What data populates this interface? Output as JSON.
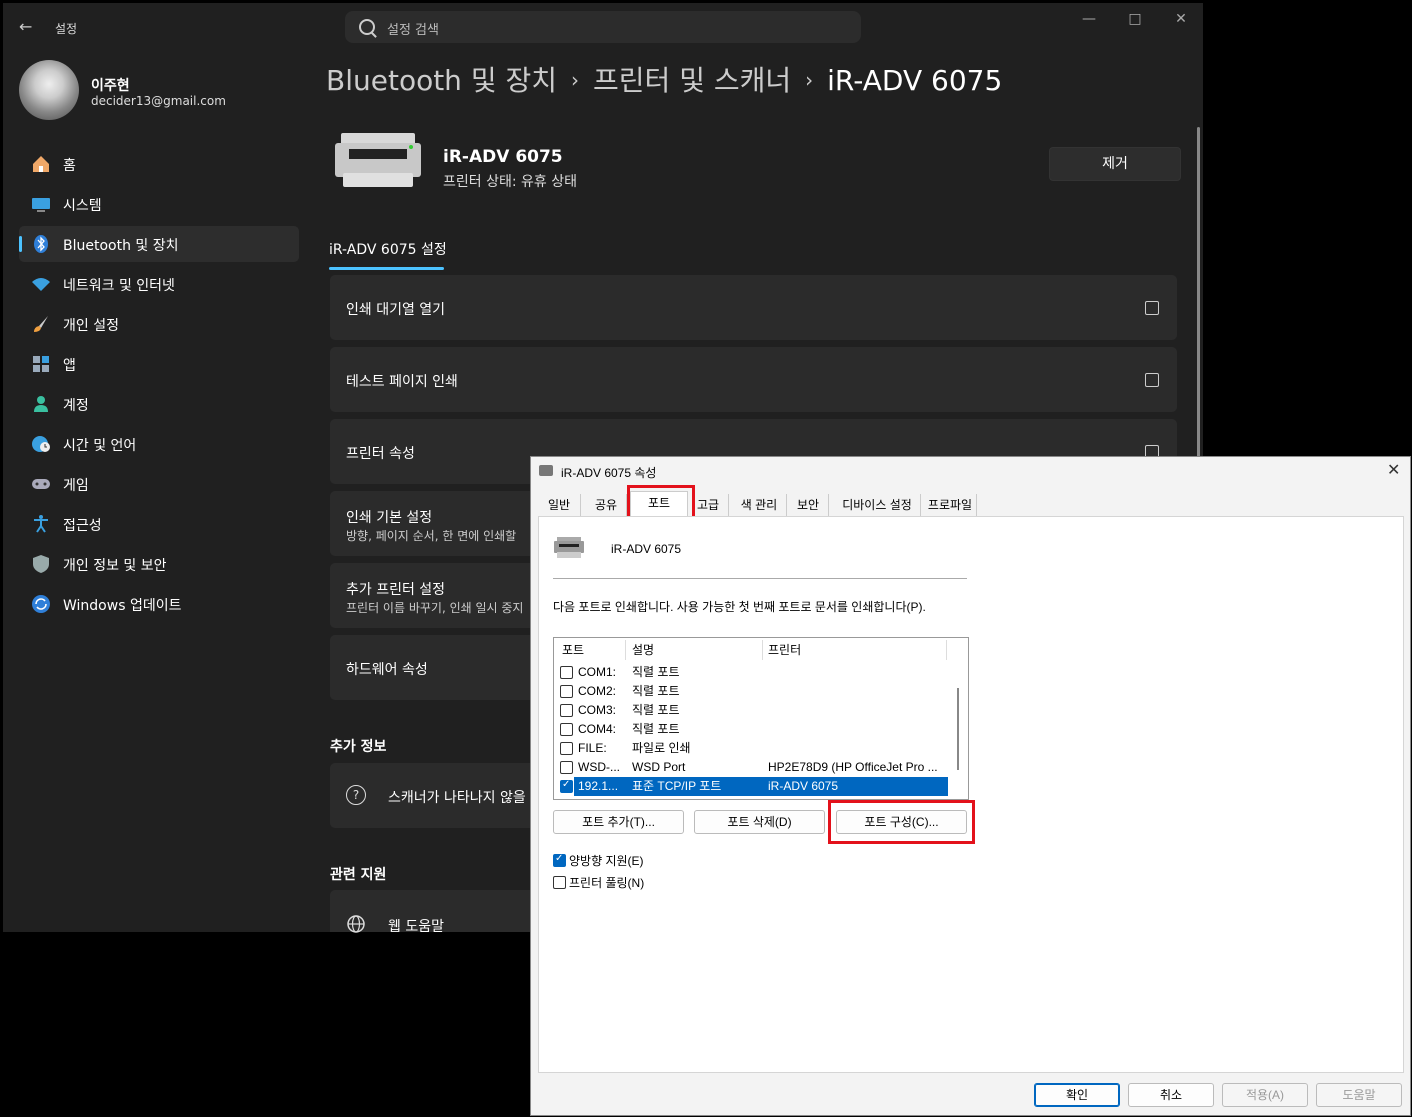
{
  "settings": {
    "title": "설정",
    "search_placeholder": "설정 검색",
    "user": {
      "name": "이주현",
      "email": "decider13@gmail.com"
    },
    "nav": [
      {
        "label": "홈",
        "icon": "home-icon"
      },
      {
        "label": "시스템",
        "icon": "system-icon"
      },
      {
        "label": "Bluetooth 및 장치",
        "icon": "bluetooth-icon",
        "active": true
      },
      {
        "label": "네트워크 및 인터넷",
        "icon": "wifi-icon"
      },
      {
        "label": "개인 설정",
        "icon": "brush-icon"
      },
      {
        "label": "앱",
        "icon": "apps-icon"
      },
      {
        "label": "계정",
        "icon": "account-icon"
      },
      {
        "label": "시간 및 언어",
        "icon": "globe-clock-icon"
      },
      {
        "label": "게임",
        "icon": "gamepad-icon"
      },
      {
        "label": "접근성",
        "icon": "accessibility-icon"
      },
      {
        "label": "개인 정보 및 보안",
        "icon": "shield-icon"
      },
      {
        "label": "Windows 업데이트",
        "icon": "update-icon"
      }
    ],
    "breadcrumb": [
      "Bluetooth 및 장치",
      "프린터 및 스캐너",
      "iR-ADV 6075"
    ],
    "printer": {
      "name": "iR-ADV 6075",
      "status": "프린터 상태:  유휴 상태",
      "remove_label": "제거"
    },
    "tab_label": "iR-ADV 6075 설정",
    "cards": [
      {
        "title": "인쇄 대기열 열기",
        "subtitle": ""
      },
      {
        "title": "테스트 페이지 인쇄",
        "subtitle": ""
      },
      {
        "title": "프린터 속성",
        "subtitle": ""
      },
      {
        "title": "인쇄 기본 설정",
        "subtitle": "방향, 페이지 순서, 한 면에 인쇄할"
      },
      {
        "title": "추가 프린터 설정",
        "subtitle": "프린터 이름 바꾸기, 인쇄 일시 중지"
      },
      {
        "title": "하드웨어 속성",
        "subtitle": ""
      }
    ],
    "more_info_heading": "추가 정보",
    "more_info_item": "스캐너가 나타나지 않을",
    "related_heading": "관련 지원",
    "related_item": "웹 도움말"
  },
  "dialog": {
    "title": "iR-ADV 6075 속성",
    "tabs": [
      "일반",
      "공유",
      "포트",
      "고급",
      "색 관리",
      "보안",
      "디바이스 설정",
      "프로파일"
    ],
    "selected_tab": "포트",
    "printer_name": "iR-ADV 6075",
    "instruction": "다음 포트로 인쇄합니다. 사용 가능한 첫 번째 포트로 문서를 인쇄합니다(P).",
    "columns": [
      "포트",
      "설명",
      "프린터"
    ],
    "ports": [
      {
        "port": "COM1:",
        "desc": "직렬 포트",
        "printer": "",
        "checked": false
      },
      {
        "port": "COM2:",
        "desc": "직렬 포트",
        "printer": "",
        "checked": false
      },
      {
        "port": "COM3:",
        "desc": "직렬 포트",
        "printer": "",
        "checked": false
      },
      {
        "port": "COM4:",
        "desc": "직렬 포트",
        "printer": "",
        "checked": false
      },
      {
        "port": "FILE:",
        "desc": "파일로 인쇄",
        "printer": "",
        "checked": false
      },
      {
        "port": "WSD-...",
        "desc": "WSD Port",
        "printer": "HP2E78D9 (HP OfficeJet Pro ...",
        "checked": false
      },
      {
        "port": "192.1...",
        "desc": "표준 TCP/IP 포트",
        "printer": "iR-ADV 6075",
        "checked": true,
        "selected": true
      }
    ],
    "add_port": "포트 추가(T)...",
    "delete_port": "포트 삭제(D)",
    "configure_port": "포트 구성(C)...",
    "bidirectional": {
      "label": "양방향 지원(E)",
      "checked": true
    },
    "pooling": {
      "label": "프린터 풀링(N)",
      "checked": false
    },
    "ok": "확인",
    "cancel": "취소",
    "apply": "적용(A)",
    "help": "도움말",
    "highlight_color": "#e3111b"
  }
}
